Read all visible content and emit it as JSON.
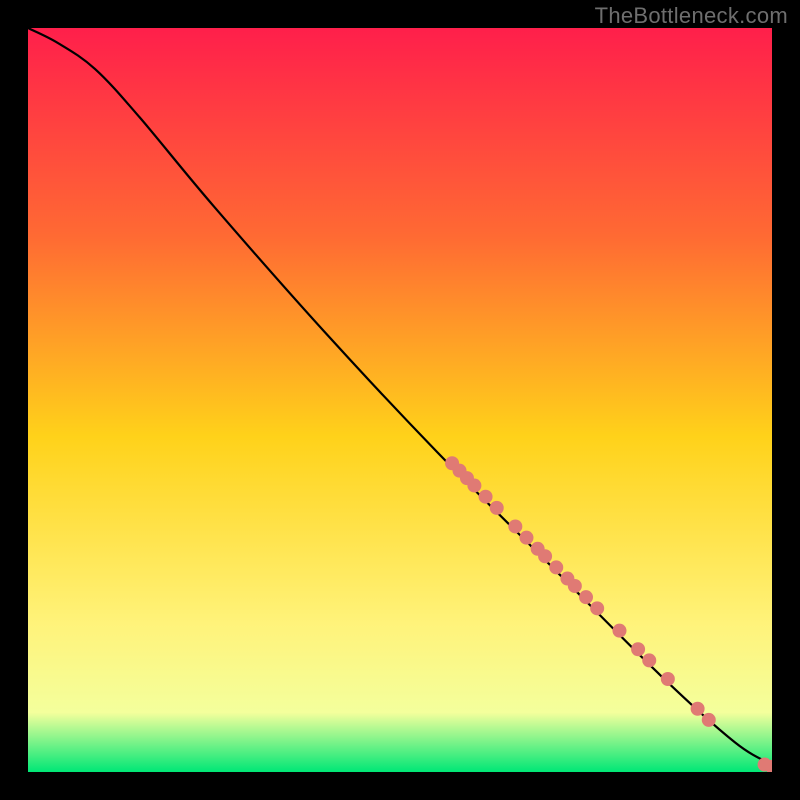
{
  "watermark": "TheBottleneck.com",
  "palette": {
    "bg": "#000000",
    "grad_top": "#ff1f4b",
    "grad_mid1": "#ff6a33",
    "grad_mid2": "#ffd21a",
    "grad_mid3": "#fff37a",
    "grad_mid4": "#f4ff9c",
    "grad_bottom": "#00e776",
    "curve": "#000000",
    "dot": "#e07a74"
  },
  "chart_data": {
    "type": "line",
    "title": "",
    "xlabel": "",
    "ylabel": "",
    "xlim": [
      0,
      100
    ],
    "ylim": [
      0,
      100
    ],
    "curve": [
      {
        "x": 0,
        "y": 100
      },
      {
        "x": 4,
        "y": 98
      },
      {
        "x": 9,
        "y": 94.5
      },
      {
        "x": 15,
        "y": 88
      },
      {
        "x": 25,
        "y": 76
      },
      {
        "x": 40,
        "y": 59
      },
      {
        "x": 55,
        "y": 43
      },
      {
        "x": 70,
        "y": 28
      },
      {
        "x": 85,
        "y": 13
      },
      {
        "x": 95,
        "y": 4
      },
      {
        "x": 100,
        "y": 1
      }
    ],
    "dots": [
      {
        "x": 57.0,
        "y": 41.5
      },
      {
        "x": 58.0,
        "y": 40.5
      },
      {
        "x": 59.0,
        "y": 39.5
      },
      {
        "x": 60.0,
        "y": 38.5
      },
      {
        "x": 61.5,
        "y": 37.0
      },
      {
        "x": 63.0,
        "y": 35.5
      },
      {
        "x": 65.5,
        "y": 33.0
      },
      {
        "x": 67.0,
        "y": 31.5
      },
      {
        "x": 68.5,
        "y": 30.0
      },
      {
        "x": 69.5,
        "y": 29.0
      },
      {
        "x": 71.0,
        "y": 27.5
      },
      {
        "x": 72.5,
        "y": 26.0
      },
      {
        "x": 73.5,
        "y": 25.0
      },
      {
        "x": 75.0,
        "y": 23.5
      },
      {
        "x": 76.5,
        "y": 22.0
      },
      {
        "x": 79.5,
        "y": 19.0
      },
      {
        "x": 82.0,
        "y": 16.5
      },
      {
        "x": 83.5,
        "y": 15.0
      },
      {
        "x": 86.0,
        "y": 12.5
      },
      {
        "x": 90.0,
        "y": 8.5
      },
      {
        "x": 91.5,
        "y": 7.0
      },
      {
        "x": 99.0,
        "y": 1.0
      },
      {
        "x": 100.0,
        "y": 0.7
      }
    ],
    "dot_radius": 7
  }
}
